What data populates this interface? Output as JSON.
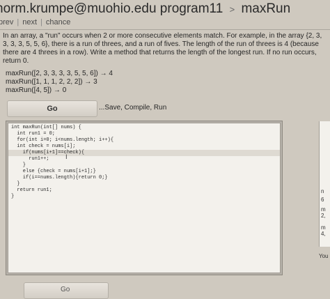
{
  "breadcrumb": {
    "user": "norm.krumpe@muohio.edu",
    "course": "program11",
    "separator": ">",
    "problem": "maxRun"
  },
  "nav": {
    "prev": "prev",
    "next": "next",
    "chance": "chance"
  },
  "description": [
    "In an array, a \"run\" occurs when 2 or more consecutive elements match. For example, in the array {2, 3,",
    "3, 3, 3, 5, 5, 6}, there is a run of threes, and a run of fives. The length of the run of threes is 4 (because",
    "there are 4 threes in a row). Write a method that returns the length of the longest run. If no run occurs,",
    "return 0."
  ],
  "examples": [
    "maxRun([2, 3, 3, 3, 3, 5, 5, 6]) → 4",
    "maxRun([1, 1, 1, 2, 2, 2]) → 3",
    "maxRun([4, 5]) → 0"
  ],
  "go_button": {
    "label": "Go",
    "hint": "...Save, Compile, Run"
  },
  "code_lines": [
    "int maxRun(int[] nums) {",
    "  int run1 = 0;",
    "  for(int i=0; i<nums.length; i++){",
    "  int check = nums[i];",
    "    if(nums[i+1]==check){",
    "      run1++;",
    "    }",
    "    else {check = nums[i+1];}",
    "    if(i==nums.length){return 0;}",
    "  }",
    "  return run1;",
    "}"
  ],
  "right_panel_fragments": [
    "n",
    "6",
    "m",
    "2,",
    "m",
    "4,"
  ],
  "right_panel_label": "You",
  "bottom_button_label": "Go"
}
